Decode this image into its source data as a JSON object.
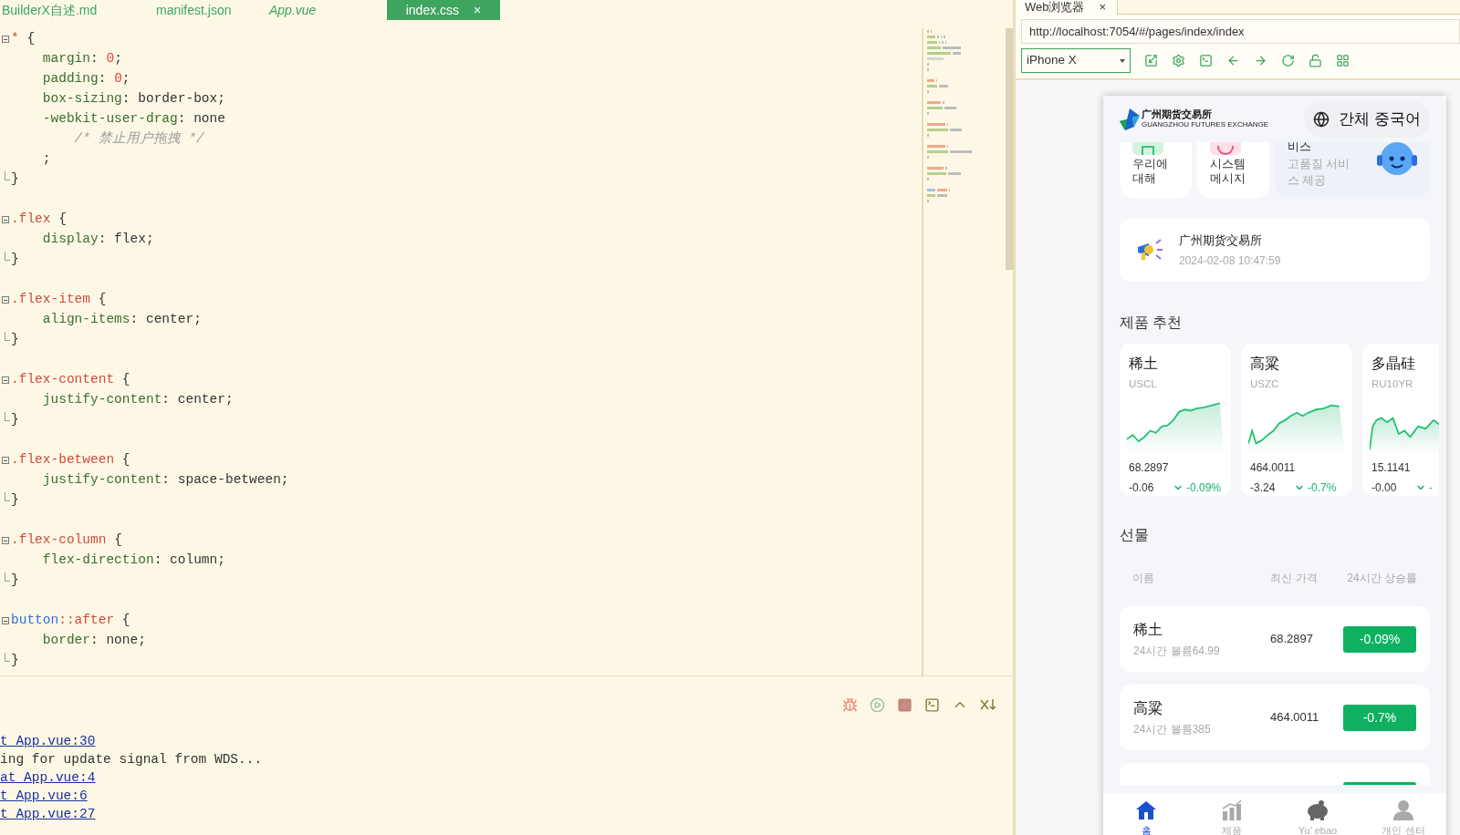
{
  "editor": {
    "tabs": [
      {
        "label": "BuilderX自述.md",
        "kind": "md",
        "selected": false
      },
      {
        "label": "manifest.json",
        "kind": "json",
        "selected": false
      },
      {
        "label": "App.vue",
        "kind": "vue",
        "selected": false
      },
      {
        "label": "index.css",
        "kind": "css",
        "selected": true,
        "close": "×"
      }
    ],
    "lines": [
      {
        "kind": "open",
        "tokens": [
          {
            "kind": "sel",
            "text": "* "
          },
          {
            "kind": "p",
            "text": "{"
          }
        ]
      },
      {
        "kind": "body",
        "tokens": [
          {
            "kind": "prop",
            "text": "    margin"
          },
          {
            "kind": "p",
            "text": ": "
          },
          {
            "kind": "num",
            "text": "0"
          },
          {
            "kind": "p",
            "text": ";"
          }
        ]
      },
      {
        "kind": "body",
        "tokens": [
          {
            "kind": "prop",
            "text": "    padding"
          },
          {
            "kind": "p",
            "text": ": "
          },
          {
            "kind": "num",
            "text": "0"
          },
          {
            "kind": "p",
            "text": ";"
          }
        ]
      },
      {
        "kind": "body",
        "tokens": [
          {
            "kind": "prop",
            "text": "    box-sizing"
          },
          {
            "kind": "p",
            "text": ": border-box;"
          }
        ]
      },
      {
        "kind": "body",
        "tokens": [
          {
            "kind": "prop",
            "text": "    -webkit-user-drag"
          },
          {
            "kind": "p",
            "text": ": none"
          }
        ]
      },
      {
        "kind": "body",
        "tokens": [
          {
            "kind": "com",
            "text": "        /* 禁止用户拖拽 */"
          }
        ]
      },
      {
        "kind": "body",
        "tokens": [
          {
            "kind": "p",
            "text": "    ;"
          }
        ]
      },
      {
        "kind": "close",
        "tokens": [
          {
            "kind": "p",
            "text": "}"
          }
        ]
      },
      {
        "kind": "blank"
      },
      {
        "kind": "open",
        "tokens": [
          {
            "kind": "sel",
            "text": ".flex "
          },
          {
            "kind": "p",
            "text": "{"
          }
        ]
      },
      {
        "kind": "body",
        "tokens": [
          {
            "kind": "prop",
            "text": "    display"
          },
          {
            "kind": "p",
            "text": ": flex;"
          }
        ]
      },
      {
        "kind": "close",
        "tokens": [
          {
            "kind": "p",
            "text": "}"
          }
        ]
      },
      {
        "kind": "blank"
      },
      {
        "kind": "open",
        "tokens": [
          {
            "kind": "sel",
            "text": ".flex-item "
          },
          {
            "kind": "p",
            "text": "{"
          }
        ]
      },
      {
        "kind": "body",
        "tokens": [
          {
            "kind": "prop",
            "text": "    align-items"
          },
          {
            "kind": "p",
            "text": ": center;"
          }
        ]
      },
      {
        "kind": "close",
        "tokens": [
          {
            "kind": "p",
            "text": "}"
          }
        ]
      },
      {
        "kind": "blank"
      },
      {
        "kind": "open",
        "tokens": [
          {
            "kind": "sel",
            "text": ".flex-content "
          },
          {
            "kind": "p",
            "text": "{"
          }
        ]
      },
      {
        "kind": "body",
        "tokens": [
          {
            "kind": "prop",
            "text": "    justify-content"
          },
          {
            "kind": "p",
            "text": ": center;"
          }
        ]
      },
      {
        "kind": "close",
        "tokens": [
          {
            "kind": "p",
            "text": "}"
          }
        ]
      },
      {
        "kind": "blank"
      },
      {
        "kind": "open",
        "tokens": [
          {
            "kind": "sel",
            "text": ".flex-between "
          },
          {
            "kind": "p",
            "text": "{"
          }
        ]
      },
      {
        "kind": "body",
        "tokens": [
          {
            "kind": "prop",
            "text": "    justify-content"
          },
          {
            "kind": "p",
            "text": ": space-between;"
          }
        ]
      },
      {
        "kind": "close",
        "tokens": [
          {
            "kind": "p",
            "text": "}"
          }
        ]
      },
      {
        "kind": "blank"
      },
      {
        "kind": "open",
        "tokens": [
          {
            "kind": "sel",
            "text": ".flex-column "
          },
          {
            "kind": "p",
            "text": "{"
          }
        ]
      },
      {
        "kind": "body",
        "tokens": [
          {
            "kind": "prop",
            "text": "    flex-direction"
          },
          {
            "kind": "p",
            "text": ": column;"
          }
        ]
      },
      {
        "kind": "close",
        "tokens": [
          {
            "kind": "p",
            "text": "}"
          }
        ]
      },
      {
        "kind": "blank"
      },
      {
        "kind": "open",
        "tokens": [
          {
            "kind": "tag",
            "text": "button"
          },
          {
            "kind": "sel",
            "text": "::after "
          },
          {
            "kind": "p",
            "text": "{"
          }
        ]
      },
      {
        "kind": "body",
        "tokens": [
          {
            "kind": "prop",
            "text": "    border"
          },
          {
            "kind": "p",
            "text": ": none;"
          }
        ]
      },
      {
        "kind": "close",
        "tokens": [
          {
            "kind": "p",
            "text": "}"
          }
        ]
      }
    ]
  },
  "console": {
    "lines": [
      {
        "kind": "link",
        "text": "t App.vue:30"
      },
      {
        "kind": "text",
        "text": "ing for update signal from WDS..."
      },
      {
        "kind": "link",
        "text": " at App.vue:4"
      },
      {
        "kind": "link",
        "text": "t App.vue:6"
      },
      {
        "kind": "link",
        "text": "t App.vue:27"
      }
    ]
  },
  "browser": {
    "tab": {
      "label": "Web浏览器",
      "close": "×"
    },
    "url": "http://localhost:7054/#/pages/index/index",
    "device": "iPhone X",
    "phone": {
      "header": {
        "logo_name": "广州期货交易所",
        "logo_subtitle": "GUANGZHOU FUTURES EXCHANGE",
        "language": "간체 중국어"
      },
      "quick_links": [
        {
          "label": "우리에 대해",
          "kind": "about"
        },
        {
          "label": "시스템 메시지",
          "kind": "message"
        },
        {
          "label": "비스",
          "subtitle": "고품질 서비스 제공",
          "kind": "service"
        }
      ],
      "notice": {
        "title": "广州期货交易所",
        "time": "2024-02-08 10:47:59"
      },
      "recommend": {
        "title": "제품 추천",
        "cards": [
          {
            "name": "稀土",
            "code": "USCL",
            "price": "68.2897",
            "change": "-0.06",
            "pct": "-0.09%"
          },
          {
            "name": "高粱",
            "code": "USZC",
            "price": "464.0011",
            "change": "-3.24",
            "pct": "-0.7%"
          },
          {
            "name": "多晶硅",
            "code": "RU10YR",
            "price": "15.1141",
            "change": "-0.00",
            "pct": "-"
          }
        ]
      },
      "futures": {
        "title": "선물",
        "columns": [
          "이름",
          "최신 가격",
          "24시간 상승률"
        ],
        "rows": [
          {
            "name": "稀土",
            "volume": "24시간 볼륨64.99",
            "price": "68.2897",
            "pct": "-0.09%"
          },
          {
            "name": "高粱",
            "volume": "24시간 볼륨385",
            "price": "464.0011",
            "pct": "-0.7%"
          }
        ]
      },
      "tabbar": [
        {
          "label": "홈",
          "kind": "home",
          "selected": true
        },
        {
          "label": "제품",
          "kind": "chart",
          "selected": false
        },
        {
          "label": "Yu’ ebao",
          "kind": "piggy",
          "selected": false
        },
        {
          "label": "개인 센터",
          "kind": "person",
          "selected": false
        }
      ]
    }
  }
}
